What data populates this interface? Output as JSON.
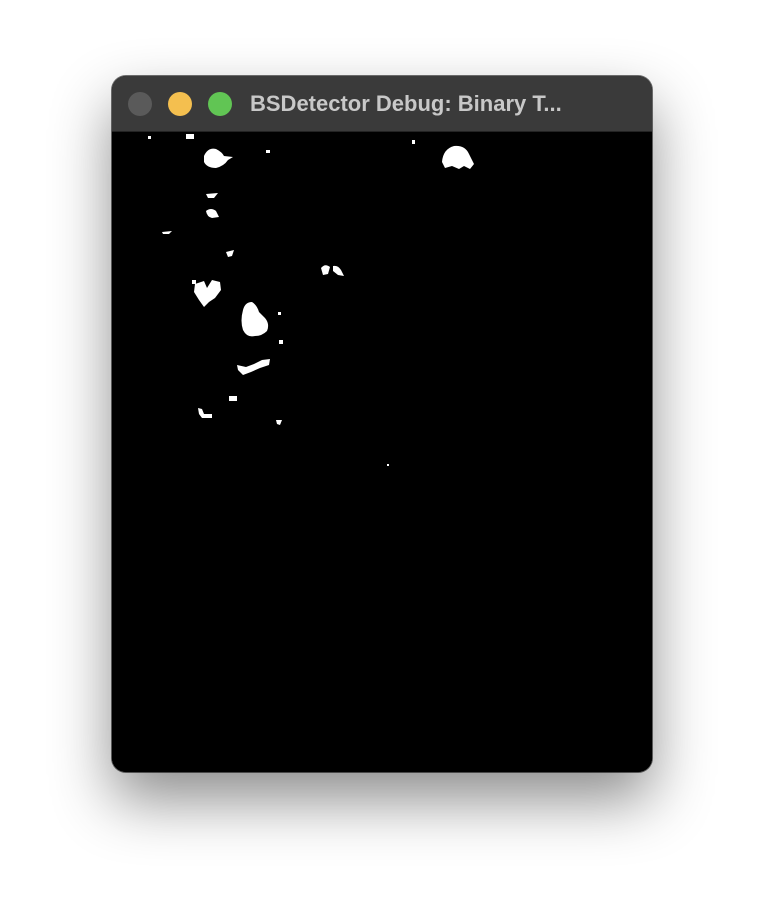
{
  "window": {
    "title": "BSDetector Debug: Binary T...",
    "traffic_lights": {
      "close": {
        "name": "close-button",
        "color": "#5a5a5a"
      },
      "minimize": {
        "name": "minimize-button",
        "color": "#f4bf4f"
      },
      "zoom": {
        "name": "zoom-button",
        "color": "#61c554"
      }
    }
  },
  "image": {
    "description_type": "binary-threshold",
    "foreground_color": "#ffffff",
    "background_color": "#000000"
  }
}
